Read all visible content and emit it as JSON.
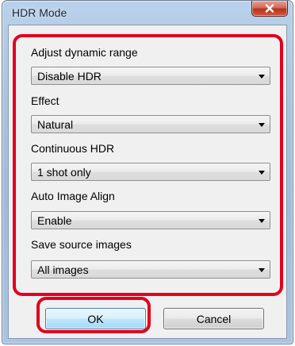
{
  "window": {
    "title": "HDR Mode"
  },
  "fields": [
    {
      "label": "Adjust dynamic range",
      "value": "Disable HDR"
    },
    {
      "label": "Effect",
      "value": "Natural"
    },
    {
      "label": "Continuous HDR",
      "value": "1 shot only"
    },
    {
      "label": "Auto Image Align",
      "value": "Enable"
    },
    {
      "label": "Save source images",
      "value": "All images"
    }
  ],
  "buttons": {
    "ok_label": "OK",
    "cancel_label": "Cancel"
  },
  "colors": {
    "highlight": "#e1001f",
    "dialog_background": "#f0f0f0",
    "frame_blue": "#a9c3df",
    "close_button_red": "#c8432c"
  },
  "icons": {
    "close": "close-icon",
    "dropdown": "chevron-down-icon"
  }
}
